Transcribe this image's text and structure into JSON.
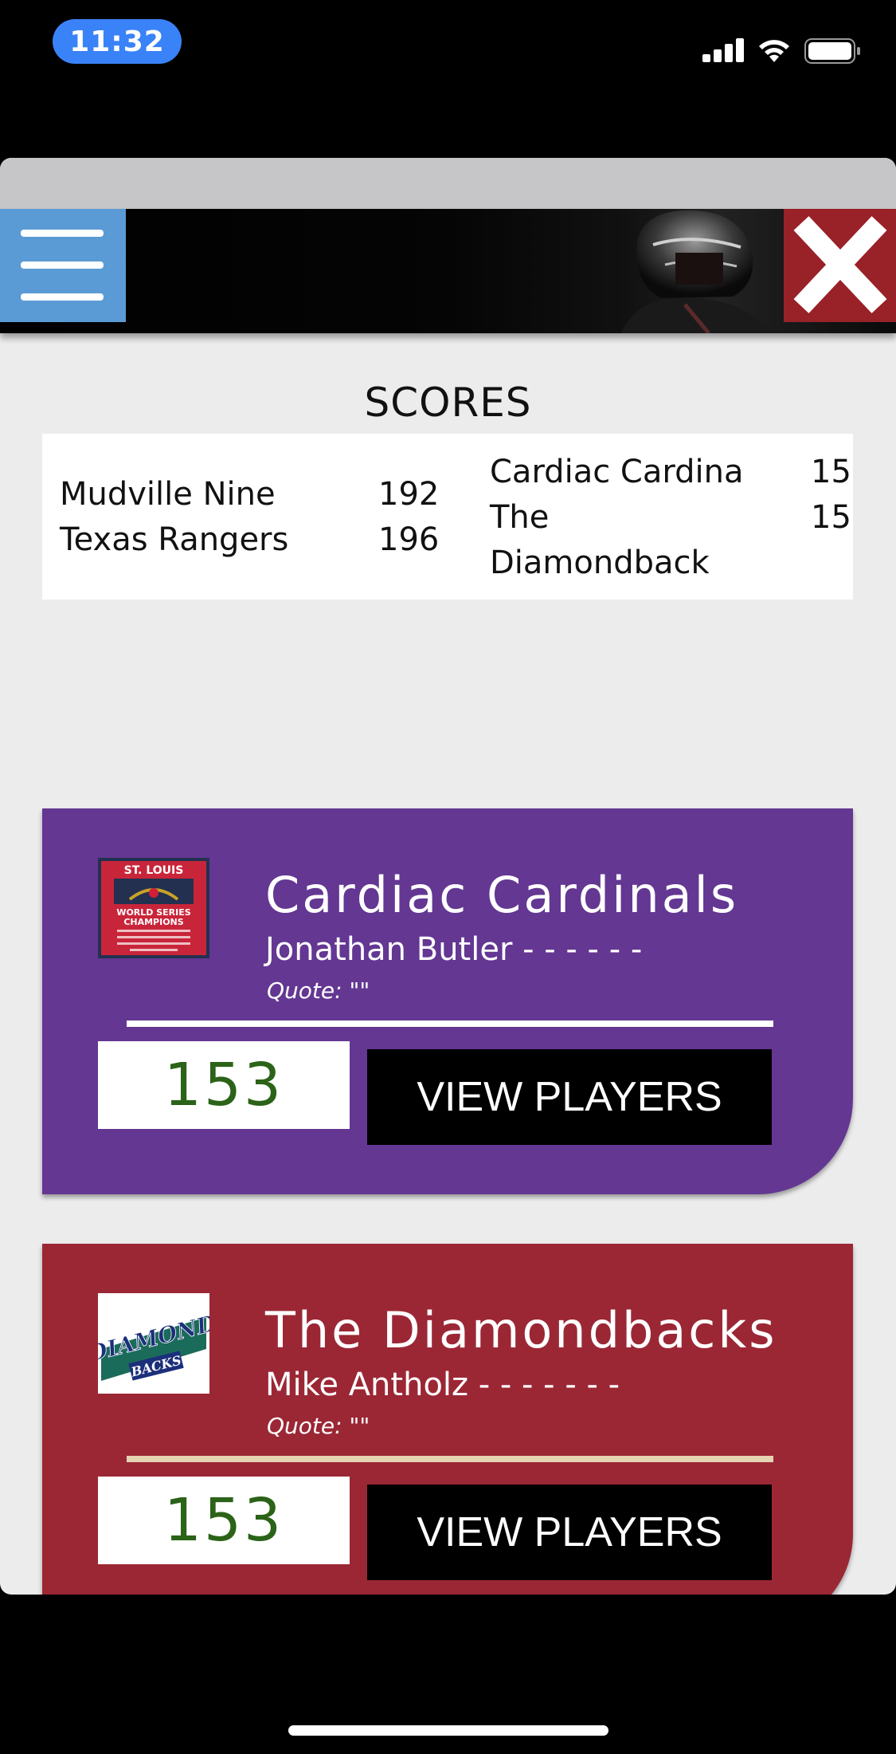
{
  "status_bar": {
    "time": "11:32"
  },
  "scores": {
    "title": "SCORES",
    "left": [
      {
        "team": "Mudville Nine",
        "score": "192"
      },
      {
        "team": "Texas Rangers",
        "score": "196"
      }
    ],
    "right": [
      {
        "team": "Cardiac Cardina",
        "score": "15"
      },
      {
        "team": "The",
        "score": "15"
      },
      {
        "team": "Diamondback",
        "score": ""
      }
    ]
  },
  "teams": [
    {
      "name": "Cardiac Cardinals",
      "coach": "Jonathan Butler - - - - - -",
      "quote": "Quote: \"\"",
      "score": "153",
      "button": "VIEW PLAYERS",
      "color": "#633792",
      "divider_color": "#ffffff",
      "logo": {
        "line1": "ST. LOUIS",
        "line2": "WORLD SERIES",
        "line3": "CHAMPIONS"
      }
    },
    {
      "name": "The Diamondbacks",
      "coach": "Mike Antholz - - - - - - -",
      "quote": "Quote: \"\"",
      "score": "153",
      "button": "VIEW PLAYERS",
      "color": "#9b2735",
      "divider_color": "#e6d3b3",
      "logo": {
        "line1": "DIAMOND",
        "line2": "BACKS"
      }
    }
  ]
}
